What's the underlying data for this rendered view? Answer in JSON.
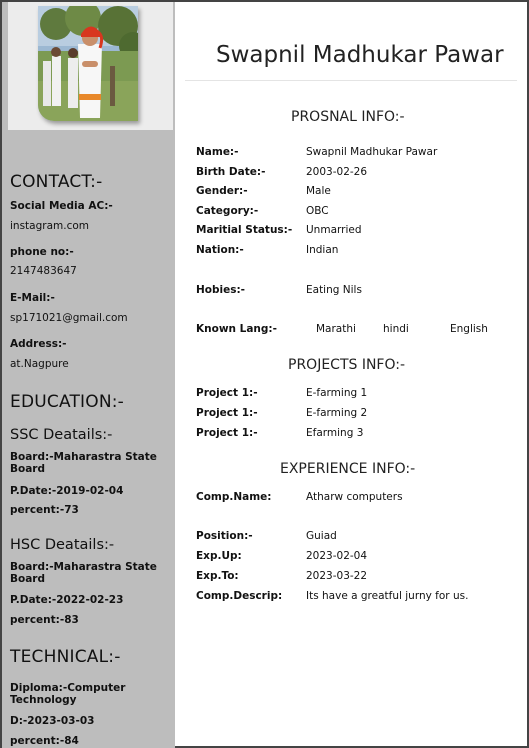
{
  "name": "Swapnil Madhukar Pawar",
  "sidebar": {
    "contact_heading": "CONTACT:-",
    "social_label": "Social Media AC:-",
    "social_value": "instagram.com",
    "phone_label": "phone no:-",
    "phone_value": "2147483647",
    "email_label": "E-Mail:-",
    "email_value": "sp171021@gmail.com",
    "address_label": "Address:-",
    "address_value": "at.Nagpure",
    "education_heading": "EDUCATION:-",
    "ssc_heading": "SSC Deatails:-",
    "ssc_board": "Board:-Maharastra State Board",
    "ssc_date": "P.Date:-2019-02-04",
    "ssc_percent": "percent:-73",
    "hsc_heading": "HSC Deatails:-",
    "hsc_board": "Board:-Maharastra State Board",
    "hsc_date": "P.Date:-2022-02-23",
    "hsc_percent": "percent:-83",
    "technical_heading": "TECHNICAL:-",
    "diploma": "Diploma:-Computer Technology",
    "diploma_date": "D:-2023-03-03",
    "diploma_percent": "percent:-84"
  },
  "personal": {
    "heading": "PROSNAL INFO:-",
    "rows": [
      {
        "label": "Name:-",
        "value": "Swapnil Madhukar Pawar"
      },
      {
        "label": "Birth Date:-",
        "value": "2003-02-26"
      },
      {
        "label": "Gender:-",
        "value": "Male"
      },
      {
        "label": "Category:-",
        "value": "OBC"
      },
      {
        "label": "Maritial Status:-",
        "value": "Unmarried"
      },
      {
        "label": "Nation:-",
        "value": "Indian"
      }
    ],
    "hobbies_label": "Hobies:-",
    "hobbies_value": "Eating Nils",
    "lang_label": "Known Lang:-",
    "languages": [
      "Marathi",
      "hindi",
      "English"
    ]
  },
  "projects": {
    "heading": "PROJECTS INFO:-",
    "rows": [
      {
        "label": "Project 1:-",
        "value": "E-farming 1"
      },
      {
        "label": "Project 1:-",
        "value": "E-farming 2"
      },
      {
        "label": "Project 1:-",
        "value": "Efarming 3"
      }
    ]
  },
  "experience": {
    "heading": "EXPERIENCE INFO:-",
    "company_label": "Comp.Name:",
    "company_value": "Atharw computers",
    "rows": [
      {
        "label": "Position:-",
        "value": "Guiad"
      },
      {
        "label": "Exp.Up:",
        "value": "2023-02-04"
      },
      {
        "label": "Exp.To:",
        "value": "2023-03-22"
      },
      {
        "label": "Comp.Descrip:",
        "value": "Its have a greatful jurny for us."
      }
    ]
  }
}
